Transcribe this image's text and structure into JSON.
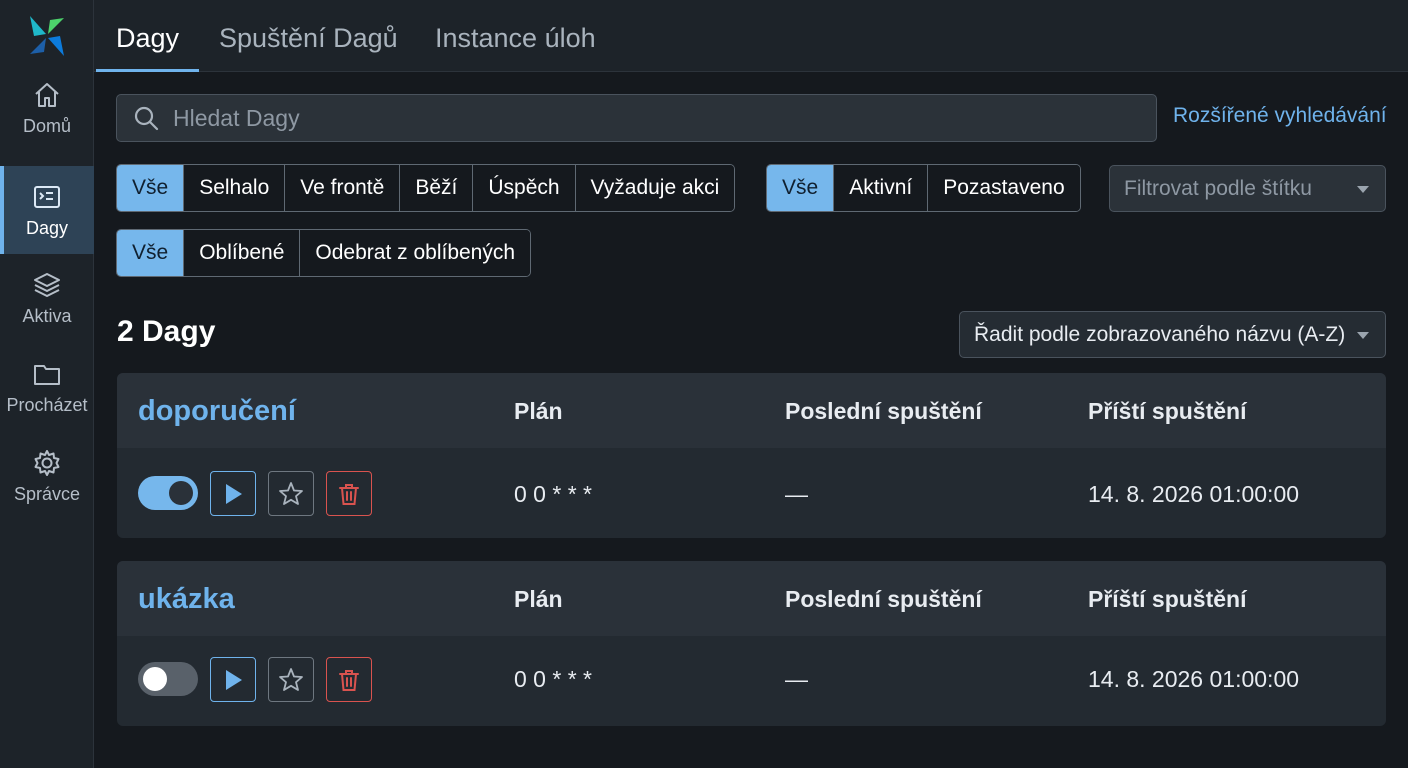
{
  "nav": {
    "logo": "airflow-logo",
    "items": [
      {
        "label": "Domů",
        "icon": "home-icon"
      },
      {
        "label": "Dagy",
        "icon": "dag-icon",
        "active": true
      },
      {
        "label": "Aktiva",
        "icon": "layers-icon"
      },
      {
        "label": "Procházet",
        "icon": "folder-icon"
      },
      {
        "label": "Správce",
        "icon": "gear-icon"
      }
    ]
  },
  "tabs": [
    {
      "label": "Dagy",
      "active": true
    },
    {
      "label": "Spuštění Dagů"
    },
    {
      "label": "Instance úloh"
    }
  ],
  "search": {
    "placeholder": "Hledat Dagy",
    "advanced_label": "Rozšířené vyhledávání"
  },
  "state_filter": {
    "options": [
      "Vše",
      "Selhalo",
      "Ve frontě",
      "Běží",
      "Úspěch",
      "Vyžaduje akci"
    ],
    "selected": "Vše"
  },
  "active_filter": {
    "options": [
      "Vše",
      "Aktivní",
      "Pozastaveno"
    ],
    "selected": "Vše"
  },
  "tag_filter": {
    "placeholder": "Filtrovat podle štítku"
  },
  "favorite_filter": {
    "options": [
      "Vše",
      "Oblíbené",
      "Odebrat z oblíbených"
    ],
    "selected": "Vše"
  },
  "list": {
    "count_title": "2 Dagy",
    "sort_label": "Řadit podle zobrazovaného názvu (A-Z)",
    "columns": {
      "schedule": "Plán",
      "last_run": "Poslední spuštění",
      "next_run": "Příští spuštění"
    },
    "dags": [
      {
        "name": "doporučení",
        "active": true,
        "schedule": "0 0 * * *",
        "last_run": "—",
        "next_run": "14. 8. 2026 01:00:00"
      },
      {
        "name": "ukázka",
        "active": false,
        "schedule": "0 0 * * *",
        "last_run": "—",
        "next_run": "14. 8. 2026 01:00:00"
      }
    ]
  },
  "colors": {
    "accent": "#6fb3ec",
    "danger": "#d9534f",
    "background": "#15191e"
  }
}
